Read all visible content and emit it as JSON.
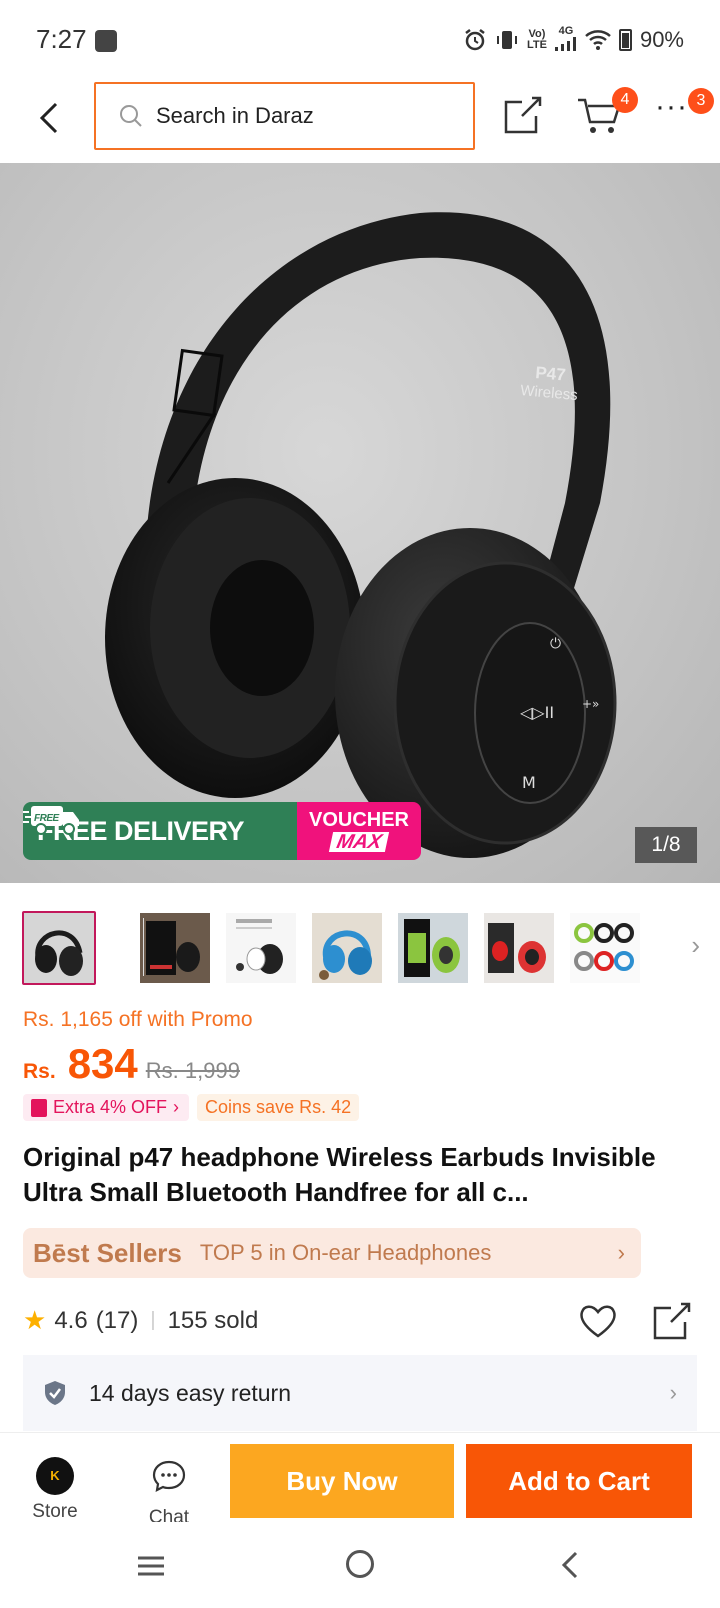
{
  "status": {
    "time": "7:27",
    "network_top": "Vo)",
    "network_bottom": "LTE",
    "net_gen": "4G",
    "battery": "90%"
  },
  "nav": {
    "search_placeholder": "Search in Daraz",
    "cart_badge": "4",
    "more_badge": "3"
  },
  "hero": {
    "product_label_line1": "P47",
    "product_label_line2": "Wireless",
    "free_delivery": "FREE DELIVERY",
    "free_tag": "FREE",
    "voucher_line1": "VOUCHER",
    "voucher_line2": "MAX",
    "page_indicator": "1/8"
  },
  "thumbnails": [
    {
      "name": "black-headphone"
    },
    {
      "name": "box-front"
    },
    {
      "name": "white-with-earbuds"
    },
    {
      "name": "blue-headphone"
    },
    {
      "name": "green-box"
    },
    {
      "name": "red-headphone"
    },
    {
      "name": "color-variants"
    }
  ],
  "pricing": {
    "promo_text": "Rs. 1,165 off with Promo",
    "currency": "Rs.",
    "price": "834",
    "original_price": "Rs. 1,999",
    "extra_off": "Extra 4% OFF",
    "coins_save": "Coins save Rs. 42"
  },
  "product": {
    "title": "Original p47 headphone Wireless Earbuds Invisible Ultra Small Bluetooth Handfree for all c..."
  },
  "bestseller": {
    "label": "Bēst Sellers",
    "text": "TOP 5 in On-ear Headphones"
  },
  "rating": {
    "value": "4.6",
    "count": "(17)",
    "sold": "155 sold"
  },
  "return_policy": {
    "text": "14 days easy return"
  },
  "bottom_bar": {
    "store_label": "Store",
    "store_logo_text": "K",
    "chat_label": "Chat",
    "buy_now": "Buy Now",
    "add_to_cart": "Add to Cart"
  },
  "colors": {
    "accent_orange": "#f85606",
    "search_border": "#f57224",
    "buy_now": "#fca720",
    "free_delivery_green": "#2f8056",
    "voucher_pink": "#f0127c"
  }
}
